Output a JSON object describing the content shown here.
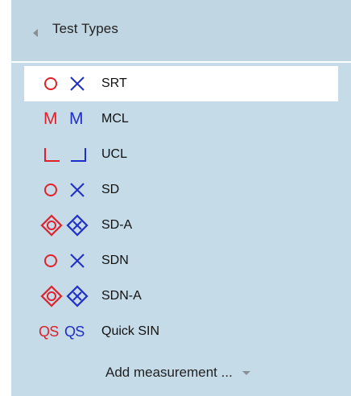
{
  "panel": {
    "title": "Test Types",
    "add_label": "Add measurement ..."
  },
  "colors": {
    "left_ear": "#e0202a",
    "right_ear": "#1f2ec8",
    "selected_row": "#ffffff",
    "panel_bg": "#c5dbe8"
  },
  "items": [
    {
      "label": "SRT",
      "left_symbol": "circle-icon",
      "right_symbol": "x-icon",
      "selected": true
    },
    {
      "label": "MCL",
      "left_symbol": "M",
      "right_symbol": "M"
    },
    {
      "label": "UCL",
      "left_symbol": "bracket-left-icon",
      "right_symbol": "bracket-right-icon"
    },
    {
      "label": "SD",
      "left_symbol": "circle-icon",
      "right_symbol": "x-icon"
    },
    {
      "label": "SD-A",
      "left_symbol": "diamond-circle-icon",
      "right_symbol": "diamond-x-icon"
    },
    {
      "label": "SDN",
      "left_symbol": "circle-icon",
      "right_symbol": "x-icon"
    },
    {
      "label": "SDN-A",
      "left_symbol": "diamond-circle-icon",
      "right_symbol": "diamond-x-icon"
    },
    {
      "label": "Quick SIN",
      "left_symbol": "QS",
      "right_symbol": "QS"
    }
  ]
}
